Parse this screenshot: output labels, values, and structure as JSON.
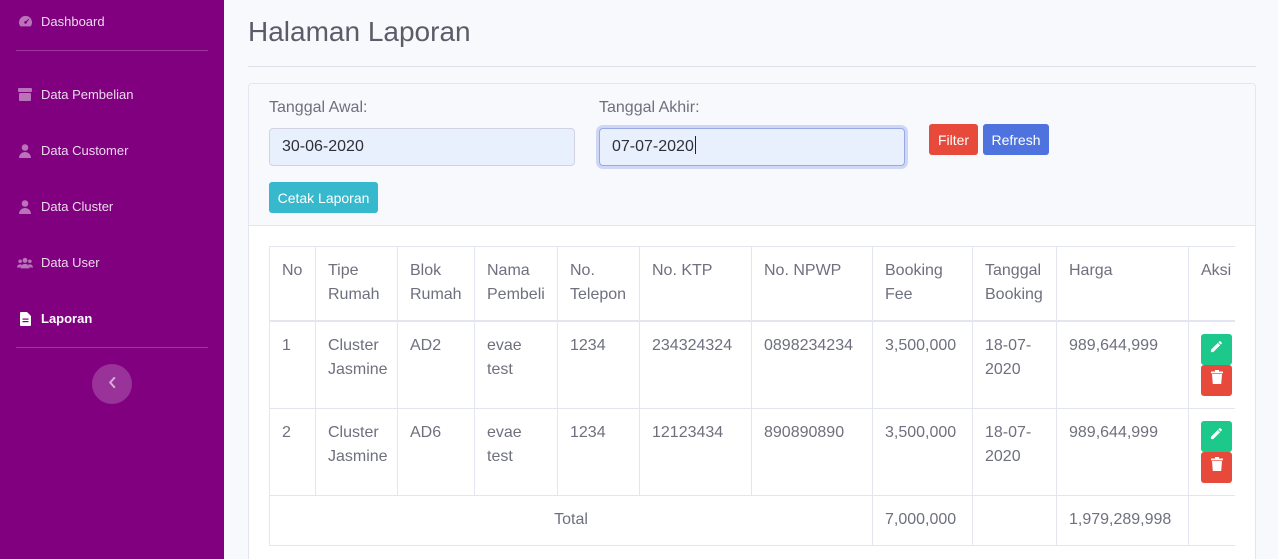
{
  "sidebar": {
    "items": [
      {
        "label": "Dashboard",
        "icon": "tachometer-icon",
        "active": false
      },
      {
        "label": "Data Pembelian",
        "icon": "box-icon",
        "active": false
      },
      {
        "label": "Data Customer",
        "icon": "user-icon",
        "active": false
      },
      {
        "label": "Data Cluster",
        "icon": "user-icon",
        "active": false
      },
      {
        "label": "Data User",
        "icon": "users-icon",
        "active": false
      },
      {
        "label": "Laporan",
        "icon": "file-icon",
        "active": true
      }
    ],
    "toggle_icon": "chevron-left-icon",
    "bg_color": "#800080"
  },
  "page": {
    "title": "Halaman Laporan"
  },
  "filter": {
    "start_label": "Tanggal Awal:",
    "start_value": "30-06-2020",
    "end_label": "Tanggal Akhir:",
    "end_value": "07-07-2020",
    "filter_button": "Filter",
    "refresh_button": "Refresh",
    "print_button": "Cetak Laporan"
  },
  "table": {
    "headers": [
      "No",
      "Tipe Rumah",
      "Blok Rumah",
      "Nama Pembeli",
      "No. Telepon",
      "No. KTP",
      "No. NPWP",
      "Booking Fee",
      "Tanggal Booking",
      "Harga",
      "Aksi"
    ],
    "rows": [
      {
        "no": "1",
        "tipe": "Cluster Jasmine",
        "blok": "AD2",
        "nama": "evae test",
        "telepon": "1234",
        "ktp": "234324324",
        "npwp": "0898234234",
        "fee": "3,500,000",
        "tanggal": "18-07-2020",
        "harga": "989,644,999"
      },
      {
        "no": "2",
        "tipe": "Cluster Jasmine",
        "blok": "AD6",
        "nama": "evae test",
        "telepon": "1234",
        "ktp": "12123434",
        "npwp": "890890890",
        "fee": "3,500,000",
        "tanggal": "18-07-2020",
        "harga": "989,644,999"
      }
    ],
    "footer": {
      "label": "Total",
      "fee_total": "7,000,000",
      "harga_total": "1,979,289,998"
    }
  },
  "colors": {
    "accent": "#4e73df",
    "danger": "#e74a3b",
    "success": "#1cc88a",
    "info": "#36b9cc"
  }
}
